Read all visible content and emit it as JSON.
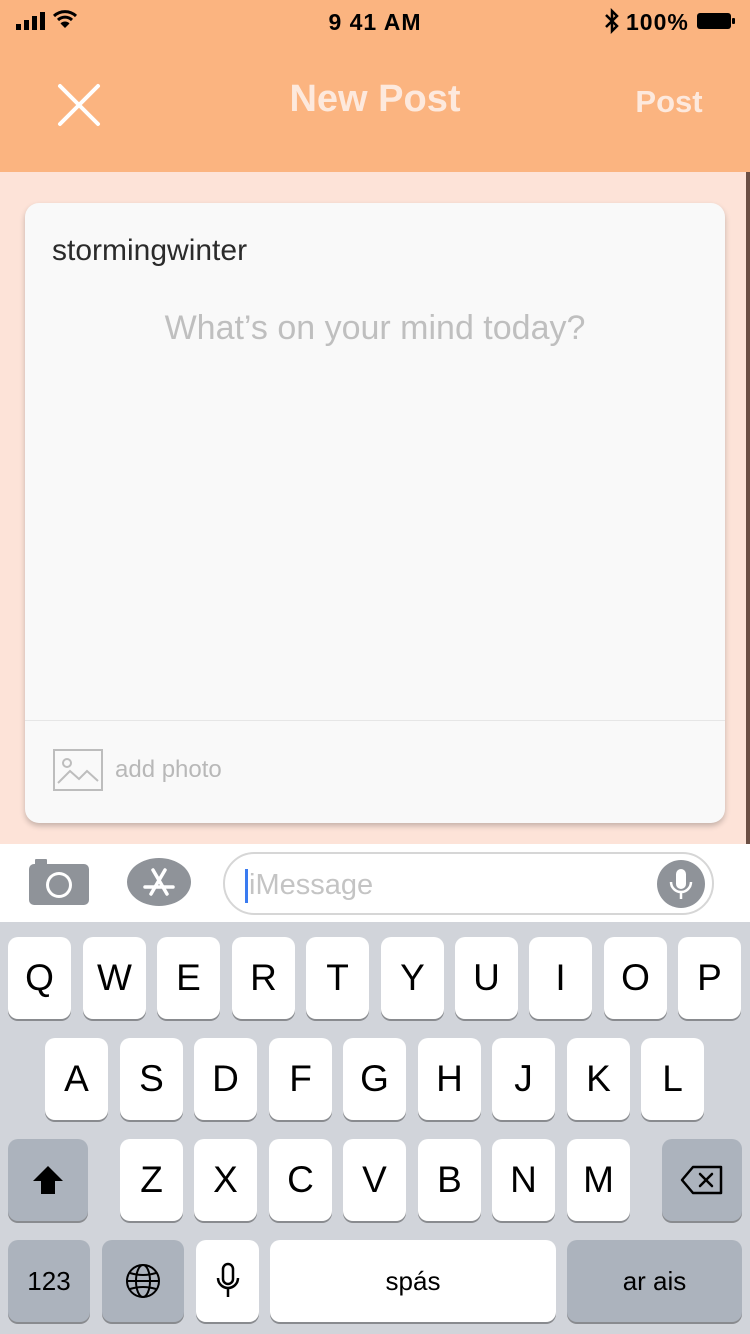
{
  "status_bar": {
    "time": "9 41 AM",
    "battery_percent": "100%"
  },
  "nav": {
    "title": "New Post",
    "post_label": "Post",
    "close_icon": "close-icon"
  },
  "post": {
    "username": "stormingwinter",
    "placeholder": "What’s on your mind today?",
    "add_photo_label": "add photo"
  },
  "message_bar": {
    "placeholder": "iMessage",
    "icons": [
      "camera-icon",
      "app-store-icon",
      "microphone-icon"
    ]
  },
  "keyboard": {
    "row1": [
      "Q",
      "W",
      "E",
      "R",
      "T",
      "Y",
      "U",
      "I",
      "O",
      "P"
    ],
    "row2": [
      "A",
      "S",
      "D",
      "F",
      "G",
      "H",
      "J",
      "K",
      "L"
    ],
    "row3": [
      "Z",
      "X",
      "C",
      "V",
      "B",
      "N",
      "M"
    ],
    "numbers_label": "123",
    "space_label": "spás",
    "return_label": "ar ais"
  },
  "colors": {
    "header_background": "#fbb480",
    "page_background": "#fde3d8",
    "header_text": "#fde9dd",
    "keyboard_background": "#d1d4da"
  }
}
